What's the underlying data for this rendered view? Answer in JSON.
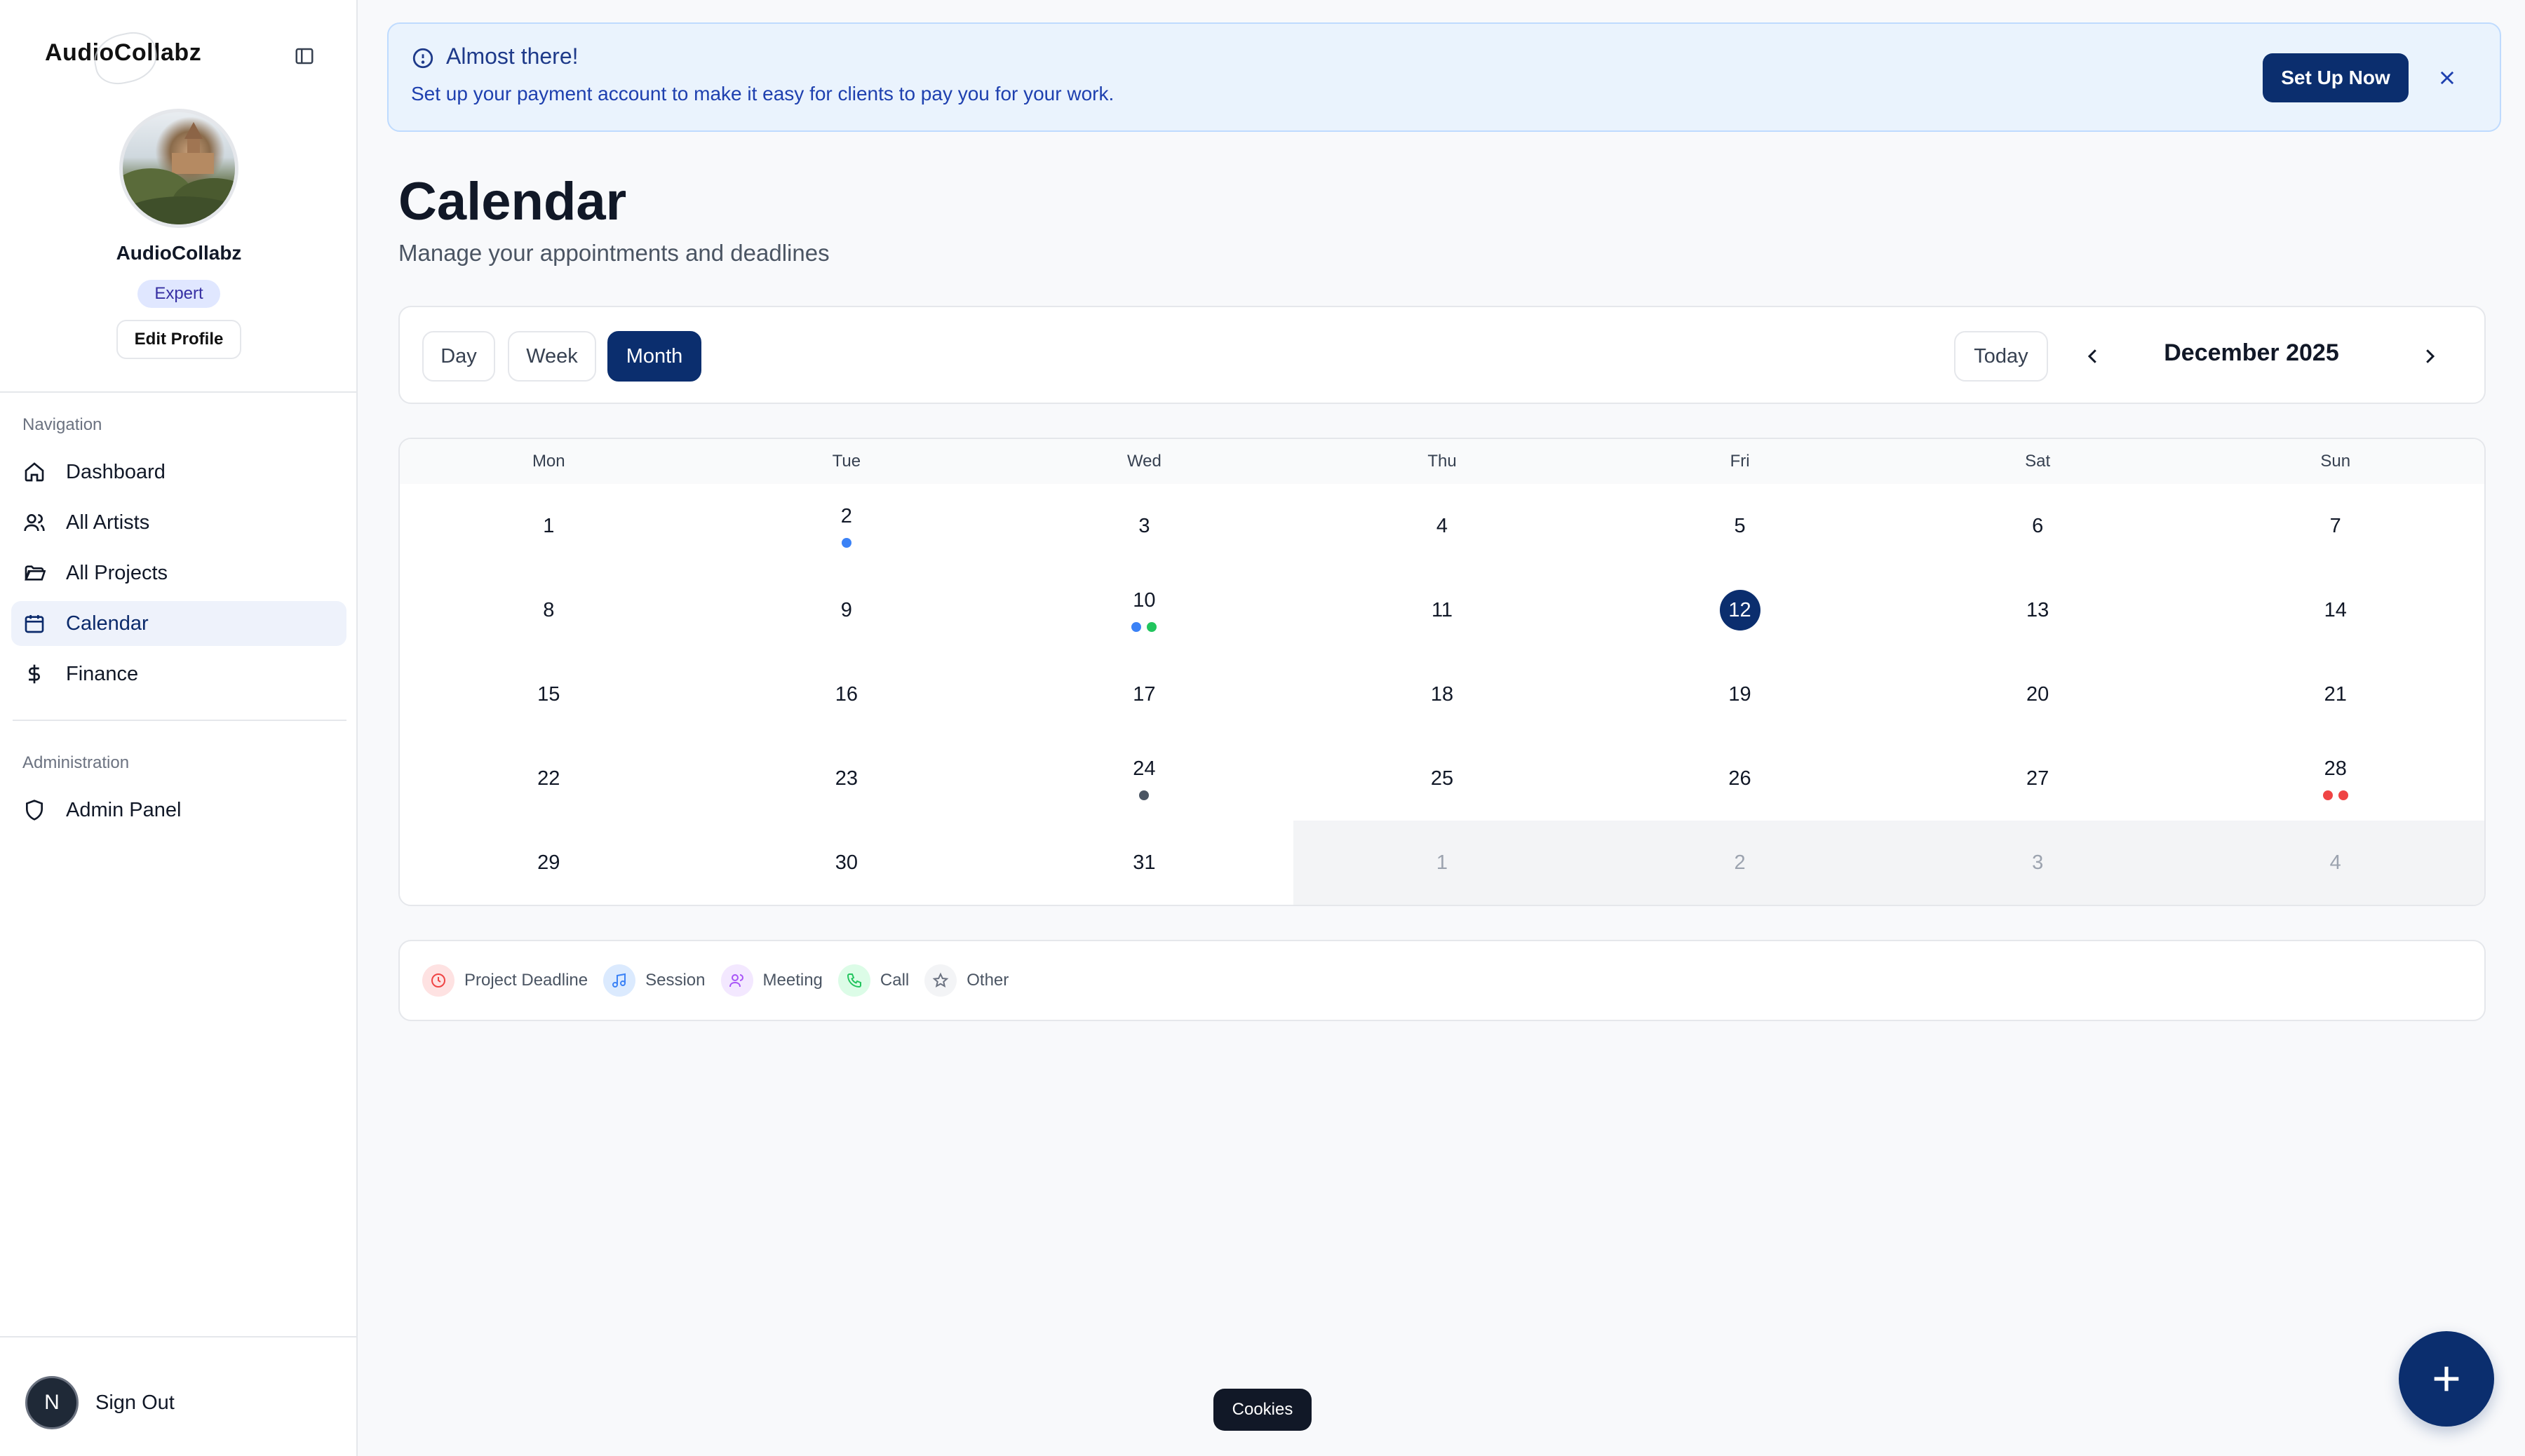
{
  "brand": {
    "name": "AudioCollabz"
  },
  "profile": {
    "name": "AudioCollabz",
    "badge": "Expert",
    "edit_label": "Edit Profile"
  },
  "sidebar": {
    "navigation_title": "Navigation",
    "items": [
      {
        "label": "Dashboard",
        "icon": "home-icon",
        "active": false
      },
      {
        "label": "All Artists",
        "icon": "users-icon",
        "active": false
      },
      {
        "label": "All Projects",
        "icon": "folder-icon",
        "active": false
      },
      {
        "label": "Calendar",
        "icon": "calendar-icon",
        "active": true
      },
      {
        "label": "Finance",
        "icon": "dollar-icon",
        "active": false
      }
    ],
    "admin_title": "Administration",
    "admin_items": [
      {
        "label": "Admin Panel",
        "icon": "shield-icon"
      }
    ],
    "signout": {
      "avatar_letter": "N",
      "label": "Sign Out"
    }
  },
  "banner": {
    "title": "Almost there!",
    "message": "Set up your payment account to make it easy for clients to pay you for your work.",
    "action_label": "Set Up Now"
  },
  "page": {
    "title": "Calendar",
    "subtitle": "Manage your appointments and deadlines"
  },
  "toolbar": {
    "views": [
      "Day",
      "Week",
      "Month"
    ],
    "active_view": "Month",
    "today_label": "Today",
    "month_label": "December 2025"
  },
  "calendar": {
    "weekdays": [
      "Mon",
      "Tue",
      "Wed",
      "Thu",
      "Fri",
      "Sat",
      "Sun"
    ],
    "today": 12,
    "weeks": [
      [
        {
          "d": "1"
        },
        {
          "d": "2",
          "dots": [
            "#3b82f6"
          ]
        },
        {
          "d": "3"
        },
        {
          "d": "4"
        },
        {
          "d": "5"
        },
        {
          "d": "6"
        },
        {
          "d": "7"
        }
      ],
      [
        {
          "d": "8"
        },
        {
          "d": "9"
        },
        {
          "d": "10",
          "dots": [
            "#3b82f6",
            "#22c55e"
          ]
        },
        {
          "d": "11"
        },
        {
          "d": "12",
          "today": true
        },
        {
          "d": "13"
        },
        {
          "d": "14"
        }
      ],
      [
        {
          "d": "15"
        },
        {
          "d": "16"
        },
        {
          "d": "17"
        },
        {
          "d": "18"
        },
        {
          "d": "19"
        },
        {
          "d": "20"
        },
        {
          "d": "21"
        }
      ],
      [
        {
          "d": "22"
        },
        {
          "d": "23"
        },
        {
          "d": "24",
          "dots": [
            "#4b5563"
          ]
        },
        {
          "d": "25"
        },
        {
          "d": "26"
        },
        {
          "d": "27"
        },
        {
          "d": "28",
          "dots": [
            "#ef4444",
            "#ef4444"
          ]
        }
      ],
      [
        {
          "d": "29"
        },
        {
          "d": "30"
        },
        {
          "d": "31"
        },
        {
          "d": "1",
          "other": true
        },
        {
          "d": "2",
          "other": true
        },
        {
          "d": "3",
          "other": true
        },
        {
          "d": "4",
          "other": true
        }
      ]
    ]
  },
  "legend": [
    {
      "label": "Project Deadline",
      "icon": "clock-icon",
      "color": "#ef4444",
      "bg": "#fee2e2"
    },
    {
      "label": "Session",
      "icon": "music-icon",
      "color": "#3b82f6",
      "bg": "#dbeafe"
    },
    {
      "label": "Meeting",
      "icon": "users-icon",
      "color": "#a855f7",
      "bg": "#f3e8ff"
    },
    {
      "label": "Call",
      "icon": "phone-icon",
      "color": "#22c55e",
      "bg": "#dcfce7"
    },
    {
      "label": "Other",
      "icon": "star-icon",
      "color": "#6b7280",
      "bg": "#f3f4f6"
    }
  ],
  "cookies_label": "Cookies",
  "colors": {
    "primary": "#0b2e6e",
    "banner_bg": "#eaf3fd",
    "active_nav_bg": "#eef2fb"
  }
}
